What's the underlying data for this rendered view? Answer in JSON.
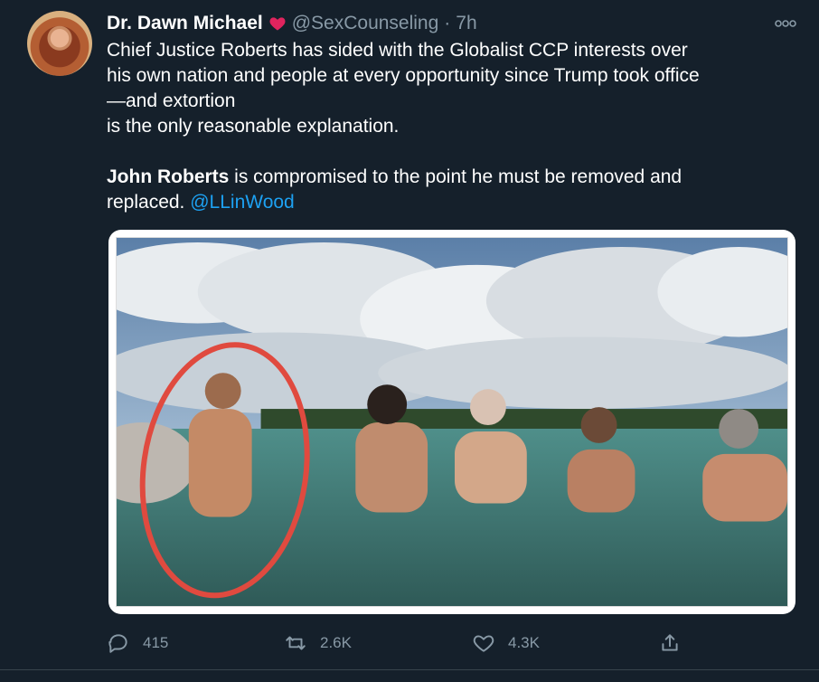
{
  "tweet": {
    "author_name": "Dr. Dawn Michael",
    "handle": "@SexCounseling",
    "separator": "·",
    "time": "7h",
    "text_lines": [
      "Chief Justice Roberts has sided with the Globalist CCP interests over",
      "his own nation and people at every opportunity since Trump took office",
      "—and extortion",
      "is the only reasonable explanation."
    ],
    "para2_bold": "John Roberts",
    "para2_rest": " is compromised to the point he must be removed and",
    "para2_line2": "replaced. ",
    "mention": "@LLinWood"
  },
  "actions": {
    "reply_count": "415",
    "retweet_count": "2.6K",
    "like_count": "4.3K"
  },
  "icons": {
    "verified_heart": "heart-icon",
    "more": "more-icon",
    "reply": "reply-icon",
    "retweet": "retweet-icon",
    "like": "like-icon",
    "share": "share-icon"
  },
  "colors": {
    "background": "#15202b",
    "secondary_text": "#8899a6",
    "link": "#1da1f2",
    "heart": "#e0245e",
    "annotation_circle": "#e04a3f"
  }
}
